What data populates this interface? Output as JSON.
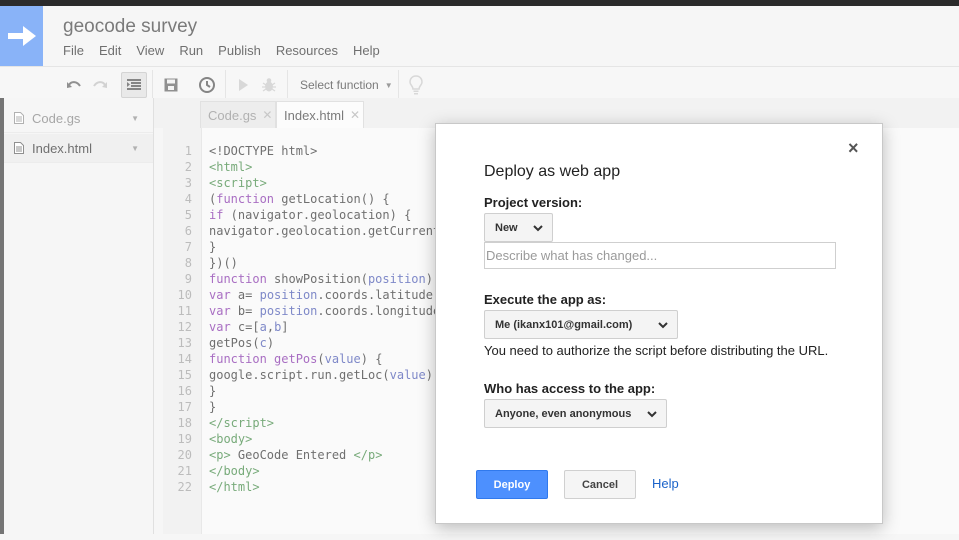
{
  "app": {
    "title": "geocode survey",
    "menu": [
      "File",
      "Edit",
      "View",
      "Run",
      "Publish",
      "Resources",
      "Help"
    ]
  },
  "toolbar": {
    "select_function": "Select function"
  },
  "files": [
    {
      "name": "Code.gs",
      "active": false
    },
    {
      "name": "Index.html",
      "active": true
    }
  ],
  "tabs": [
    {
      "label": "Code.gs",
      "active": false
    },
    {
      "label": "Index.html",
      "active": true
    }
  ],
  "code": {
    "line_numbers": [
      "1",
      "2",
      "3",
      "4",
      "5",
      "6",
      "7",
      "8",
      "9",
      "10",
      "11",
      "12",
      "13",
      "14",
      "15",
      "16",
      "17",
      "18",
      "19",
      "20",
      "21",
      "22"
    ]
  },
  "dialog": {
    "title": "Deploy as web app",
    "project_version_label": "Project version:",
    "project_version_value": "New",
    "description_placeholder": "Describe what has changed...",
    "execute_as_label": "Execute the app as:",
    "execute_as_value": "Me (ikanx101@gmail.com)",
    "authorize_note": "You need to authorize the script before distributing the URL.",
    "access_label": "Who has access to the app:",
    "access_value": "Anyone, even anonymous",
    "deploy_label": "Deploy",
    "cancel_label": "Cancel",
    "help_label": "Help",
    "close_glyph": "×"
  },
  "colors": {
    "accent": "#4a8af4",
    "deploy_button": "#4d90fe",
    "link": "#1a62c9",
    "tag": "#2e7d32",
    "keyword": "#7a1fa2"
  }
}
